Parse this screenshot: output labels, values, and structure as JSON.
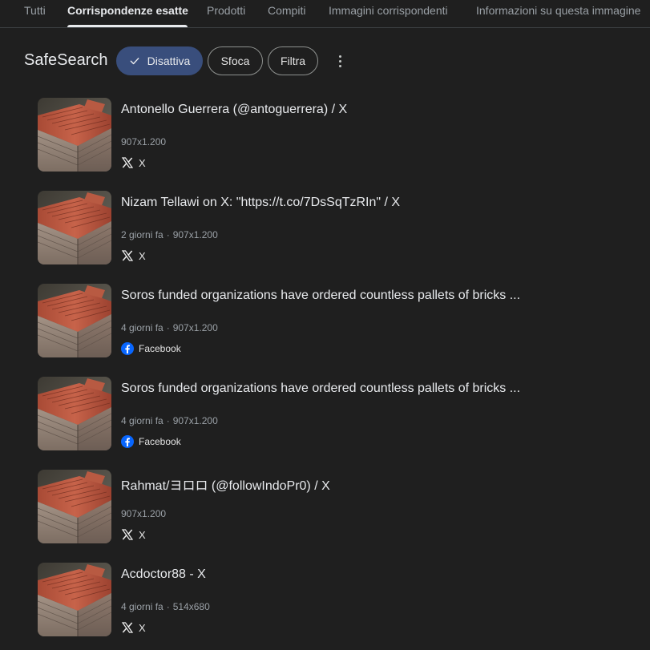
{
  "tabs": [
    {
      "label": "Tutti",
      "active": false
    },
    {
      "label": "Corrispondenze esatte",
      "active": true
    },
    {
      "label": "Prodotti",
      "active": false
    },
    {
      "label": "Compiti",
      "active": false
    },
    {
      "label": "Immagini corrispondenti",
      "active": false
    },
    {
      "label": "Informazioni su questa immagine",
      "active": false
    }
  ],
  "filters": {
    "safesearch_label": "SafeSearch",
    "chips": [
      {
        "label": "Disattiva",
        "selected": true,
        "icon": "check-icon"
      },
      {
        "label": "Sfoca",
        "selected": false
      },
      {
        "label": "Filtra",
        "selected": false
      }
    ],
    "more_icon": "more-vert-icon"
  },
  "results": [
    {
      "title": "Antonello Guerrera (@antoguerrera) / X",
      "age": "",
      "dimensions": "907x1.200",
      "source": "X",
      "source_icon": "x-logo-icon"
    },
    {
      "title": "Nizam Tellawi on X: \"https://t.co/7DsSqTzRIn\" / X",
      "age": "2 giorni fa",
      "dimensions": "907x1.200",
      "source": "X",
      "source_icon": "x-logo-icon"
    },
    {
      "title": "Soros funded organizations have ordered countless pallets of bricks ...",
      "age": "4 giorni fa",
      "dimensions": "907x1.200",
      "source": "Facebook",
      "source_icon": "facebook-icon"
    },
    {
      "title": "Soros funded organizations have ordered countless pallets of bricks ...",
      "age": "4 giorni fa",
      "dimensions": "907x1.200",
      "source": "Facebook",
      "source_icon": "facebook-icon"
    },
    {
      "title": "Rahmat/ヨロロ (@followIndoPr0) / X",
      "age": "",
      "dimensions": "907x1.200",
      "source": "X",
      "source_icon": "x-logo-icon"
    },
    {
      "title": "Acdoctor88 - X",
      "age": "4 giorni fa",
      "dimensions": "514x680",
      "source": "X",
      "source_icon": "x-logo-icon"
    }
  ],
  "colors": {
    "background": "#1f1f1f",
    "chip_selected": "#394e7c",
    "facebook": "#0866ff"
  }
}
